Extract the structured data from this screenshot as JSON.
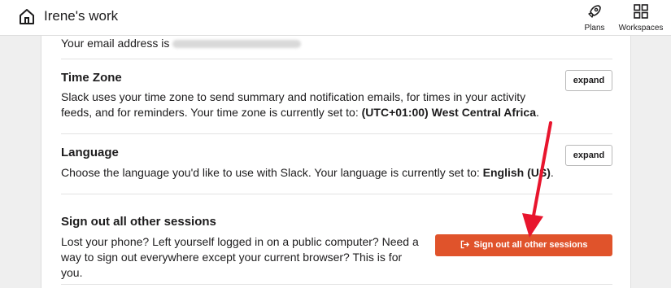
{
  "header": {
    "workspace_title": "Irene's work",
    "nav": [
      {
        "label": "Plans",
        "icon": "rocket-icon"
      },
      {
        "label": "Workspaces",
        "icon": "grid-icon"
      }
    ]
  },
  "settings": {
    "email": {
      "prefix": "Your email address is"
    },
    "timezone": {
      "title": "Time Zone",
      "desc_prefix": "Slack uses your time zone to send summary and notification emails, for times in your activity feeds, and for reminders. Your time zone is currently set to:",
      "desc_value": "(UTC+01:00) West Central Africa",
      "desc_suffix": ".",
      "button_label": "expand"
    },
    "language": {
      "title": "Language",
      "desc_prefix": "Choose the language you'd like to use with Slack. Your language is currently set to:",
      "desc_value": "English (US)",
      "desc_suffix": ".",
      "button_label": "expand"
    },
    "signout": {
      "title": "Sign out all other sessions",
      "desc": "Lost your phone? Left yourself logged in on a public computer? Need a way to sign out everywhere except your current browser? This is for you.",
      "button_label": "Sign out all other sessions"
    }
  },
  "colors": {
    "accent_button": "#e0532b",
    "annotation_arrow": "#e8152d"
  }
}
